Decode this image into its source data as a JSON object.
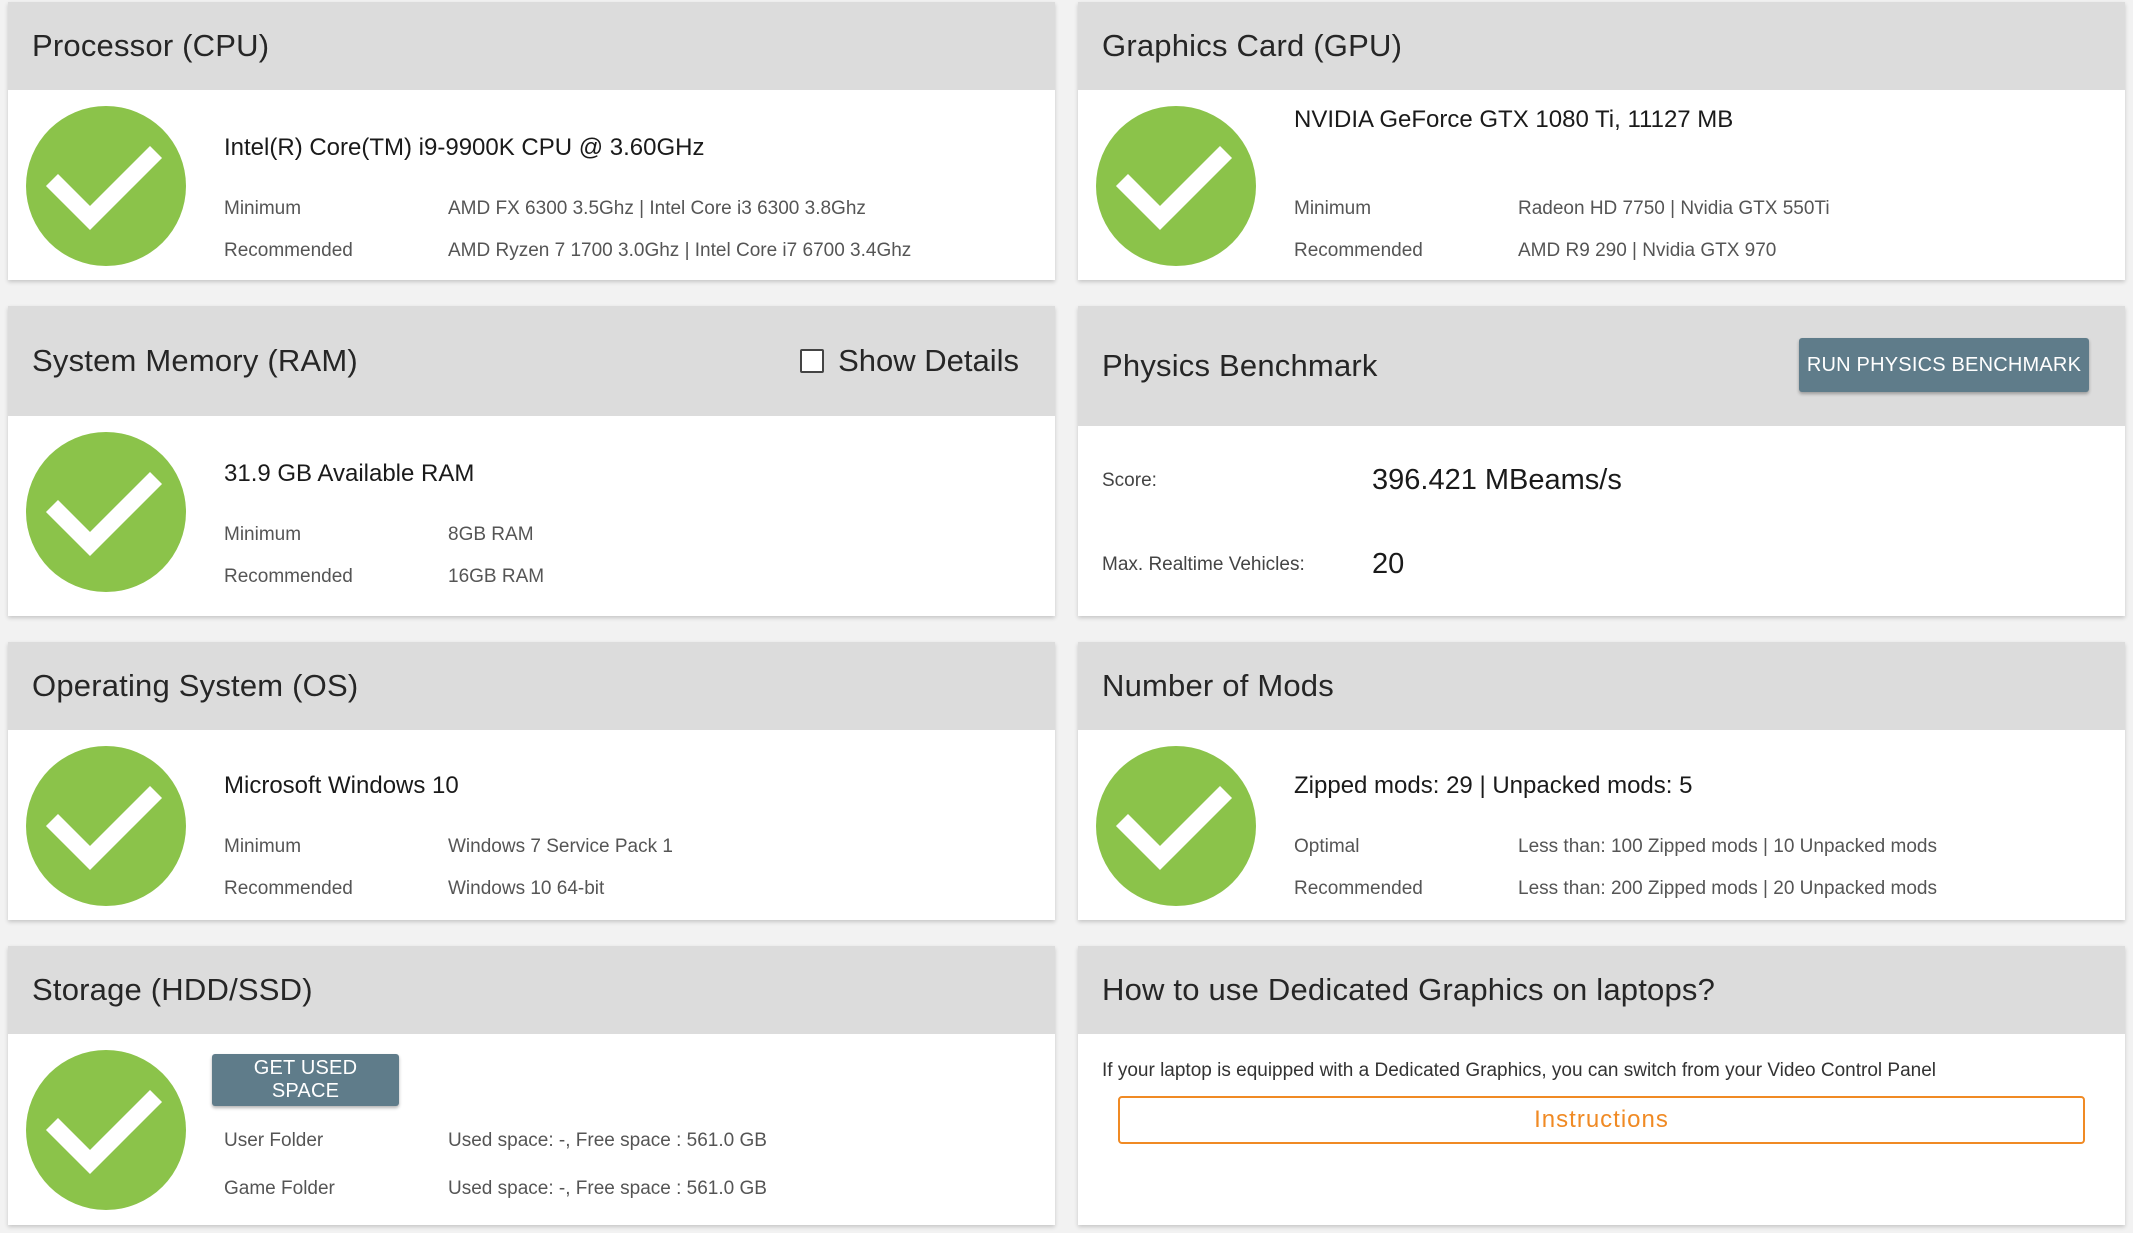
{
  "colors": {
    "check_green": "#8bc34a",
    "header_grey": "#dcdcdc",
    "button_slate": "#5f7c8a",
    "accent_orange": "#f08a24"
  },
  "cpu": {
    "title": "Processor (CPU)",
    "status_icon": "checkmark-icon",
    "detected": "Intel(R) Core(TM) i9-9900K CPU @ 3.60GHz",
    "min_label": "Minimum",
    "min_value": "AMD FX 6300 3.5Ghz | Intel Core i3 6300 3.8Ghz",
    "rec_label": "Recommended",
    "rec_value": "AMD Ryzen 7 1700 3.0Ghz | Intel Core i7 6700 3.4Ghz"
  },
  "gpu": {
    "title": "Graphics Card (GPU)",
    "status_icon": "checkmark-icon",
    "detected": "NVIDIA GeForce GTX 1080 Ti, 11127 MB",
    "min_label": "Minimum",
    "min_value": "Radeon HD 7750 | Nvidia GTX 550Ti",
    "rec_label": "Recommended",
    "rec_value": "AMD R9 290 | Nvidia GTX 970"
  },
  "ram": {
    "title": "System Memory (RAM)",
    "show_details_label": "Show Details",
    "show_details_checked": false,
    "status_icon": "checkmark-icon",
    "detected": "31.9 GB Available RAM",
    "min_label": "Minimum",
    "min_value": "8GB RAM",
    "rec_label": "Recommended",
    "rec_value": "16GB RAM"
  },
  "physics": {
    "title": "Physics Benchmark",
    "run_button_label": "RUN PHYSICS BENCHMARK",
    "score_label": "Score:",
    "score_value": "396.421 MBeams/s",
    "vehicles_label": "Max. Realtime Vehicles:",
    "vehicles_value": "20"
  },
  "os": {
    "title": "Operating System (OS)",
    "status_icon": "checkmark-icon",
    "detected": "Microsoft Windows 10",
    "min_label": "Minimum",
    "min_value": "Windows 7 Service Pack 1",
    "rec_label": "Recommended",
    "rec_value": "Windows 10 64-bit"
  },
  "mods": {
    "title": "Number of Mods",
    "status_icon": "checkmark-icon",
    "detected": "Zipped mods: 29 | Unpacked mods: 5",
    "opt_label": "Optimal",
    "opt_value": "Less than: 100 Zipped mods | 10 Unpacked mods",
    "rec_label": "Recommended",
    "rec_value": "Less than: 200 Zipped mods | 20 Unpacked mods"
  },
  "storage": {
    "title": "Storage (HDD/SSD)",
    "status_icon": "checkmark-icon",
    "get_space_label": "GET USED SPACE",
    "user_label": "User Folder",
    "user_value": "Used space: -, Free space : 561.0 GB",
    "game_label": "Game Folder",
    "game_value": "Used space: -, Free space : 561.0 GB"
  },
  "laptop": {
    "title": "How to use Dedicated Graphics on laptops?",
    "description": "If your laptop is equipped with a Dedicated Graphics, you can switch from your Video Control Panel",
    "instructions_label": "Instructions"
  }
}
